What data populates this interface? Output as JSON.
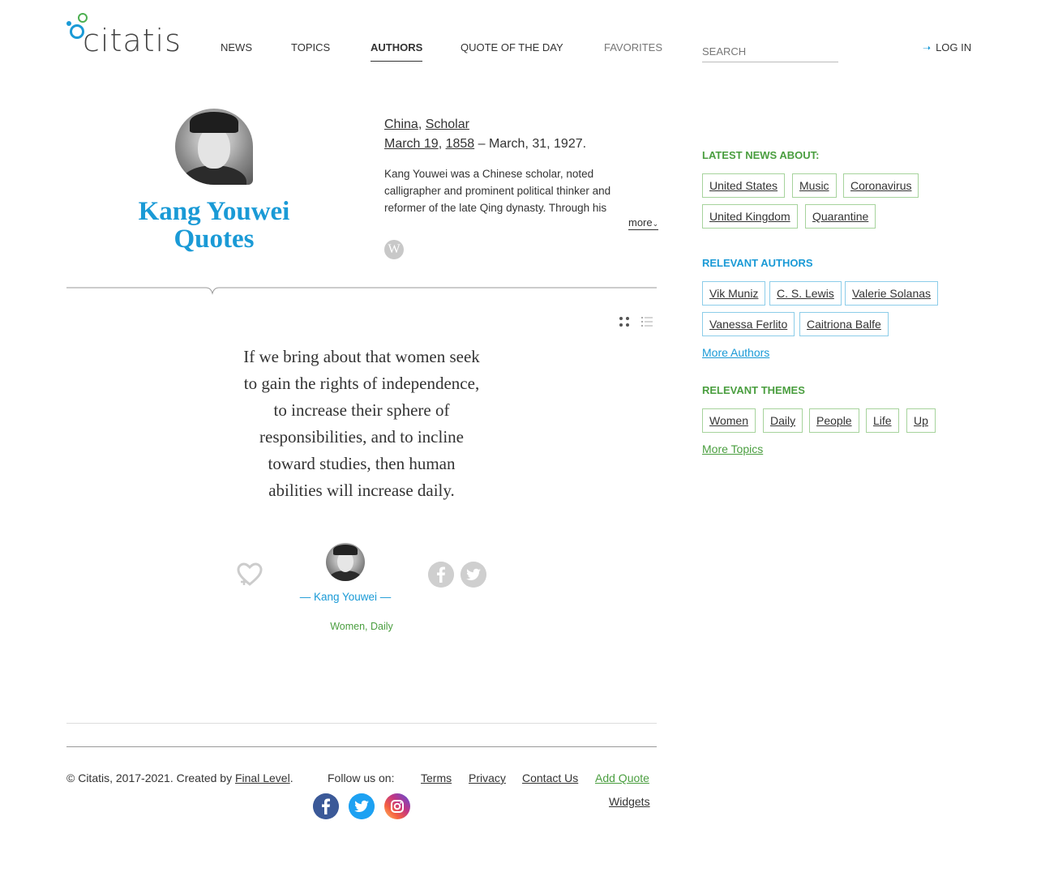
{
  "header": {
    "logo_text": "citatis",
    "nav": [
      {
        "label": "NEWS"
      },
      {
        "label": "TOPICS"
      },
      {
        "label": "AUTHORS"
      },
      {
        "label": "QUOTE OF THE DAY"
      },
      {
        "label": "FAVORITES"
      }
    ],
    "search_placeholder": "SEARCH",
    "login_label": "LOG IN"
  },
  "author": {
    "title_name": "Kang Youwei",
    "title_suffix": "Quotes",
    "country": "China",
    "profession": "Scholar",
    "birth_date": "March 19",
    "birth_year": "1858",
    "death": "– March, 31, 1927.",
    "bio": "Kang Youwei was a Chinese scholar, noted calligrapher and prominent political thinker and reformer of the late Qing dynasty. Through his",
    "more_label": "more",
    "wiki_label": "W"
  },
  "quote": {
    "text": "If we bring about that women seek to gain the rights of independence, to increase their sphere of responsibilities, and to incline toward studies, then human abilities will increase daily.",
    "author_label": "— Kang Youwei —",
    "tags": [
      "Women",
      "Daily"
    ]
  },
  "sidebar": {
    "news_heading": "LATEST NEWS ABOUT:",
    "news_tags": [
      "United States",
      "Music",
      "Coronavirus",
      "United Kingdom",
      "Quarantine"
    ],
    "authors_heading": "RELEVANT AUTHORS",
    "authors": [
      "Vik Muniz",
      "C. S. Lewis",
      "Valerie Solanas",
      "Vanessa Ferlito",
      "Caitriona Balfe"
    ],
    "more_authors": "More Authors",
    "themes_heading": "RELEVANT THEMES",
    "themes": [
      "Women",
      "Daily",
      "People",
      "Life",
      "Up"
    ],
    "more_topics": "More Topics"
  },
  "footer": {
    "copyright_prefix": "© Citatis, 2017-2021. Created by",
    "creator": "Final Level",
    "copyright_suffix": ".",
    "follow_label": "Follow us on:",
    "links": [
      "Terms",
      "Privacy",
      "Contact Us",
      "Add Quote",
      "Widgets"
    ]
  },
  "colors": {
    "accent_blue": "#1a9ad6",
    "accent_green": "#4a9e3f"
  }
}
